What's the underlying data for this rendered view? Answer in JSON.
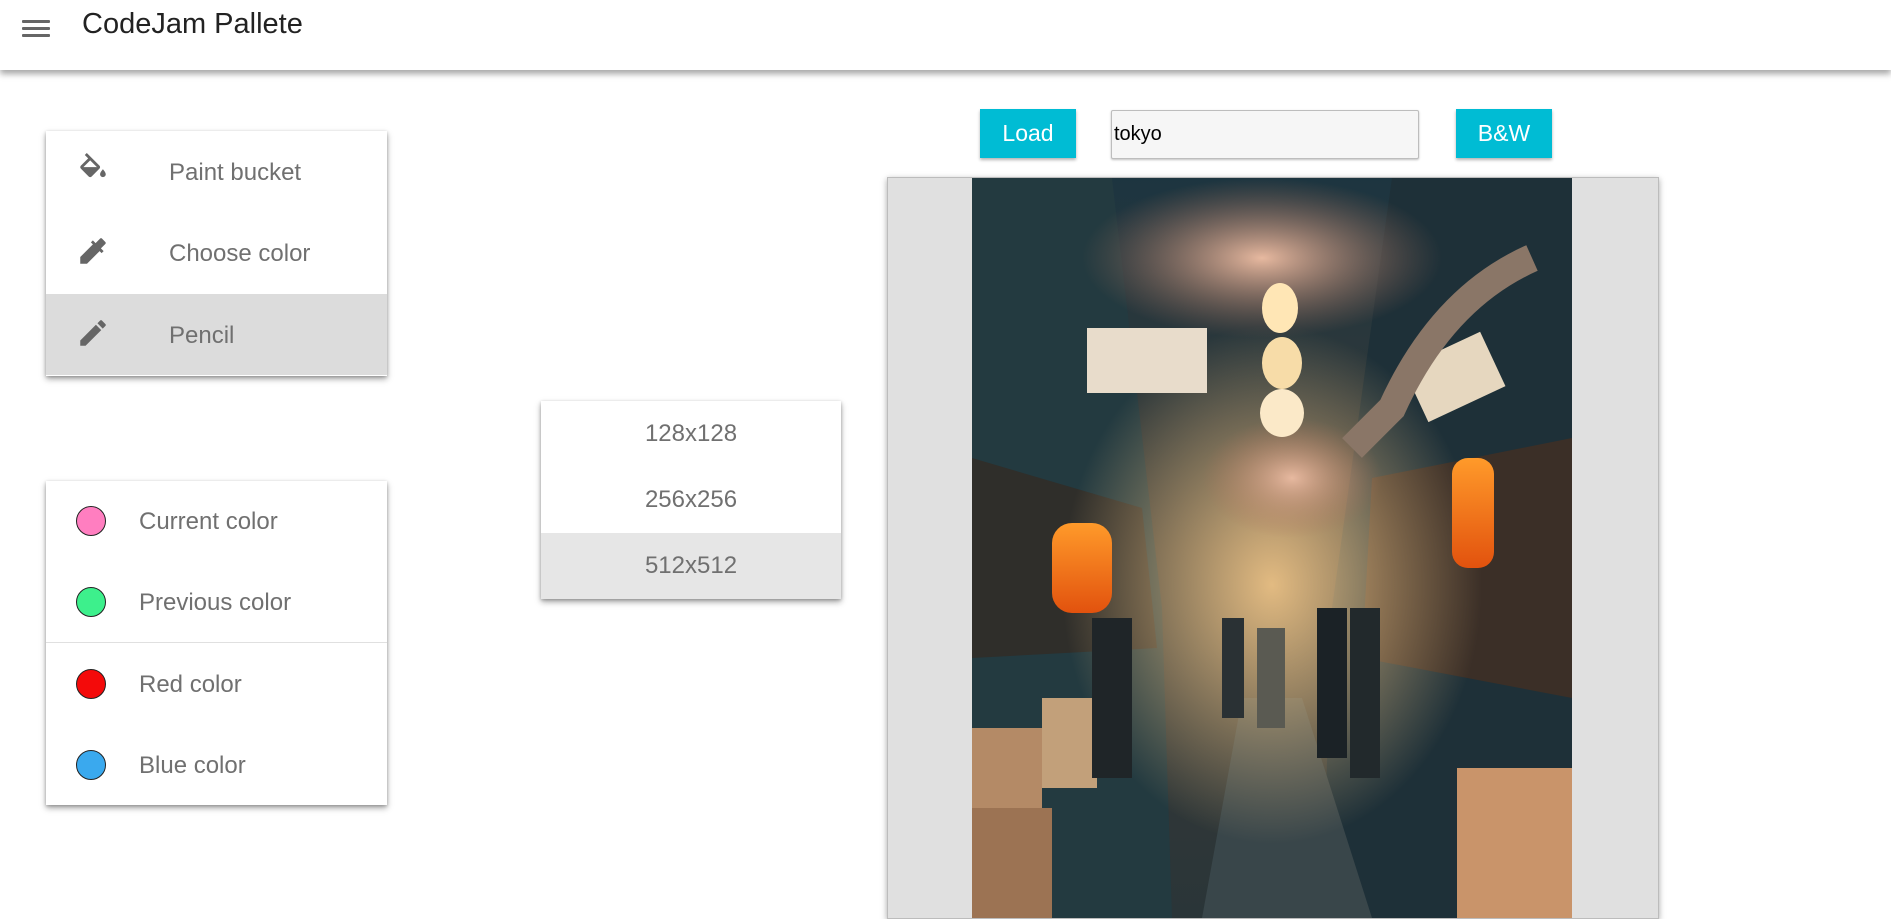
{
  "app": {
    "title": "CodeJam Pallete"
  },
  "tools": {
    "items": [
      {
        "id": "paint-bucket",
        "label": "Paint bucket",
        "icon": "paint-bucket-icon",
        "active": false
      },
      {
        "id": "choose-color",
        "label": "Choose color",
        "icon": "eyedropper-icon",
        "active": false
      },
      {
        "id": "pencil",
        "label": "Pencil",
        "icon": "pencil-icon",
        "active": true
      }
    ]
  },
  "colors": {
    "items": [
      {
        "id": "current",
        "label": "Current color",
        "color": "#ff7ec0"
      },
      {
        "id": "previous",
        "label": "Previous color",
        "color": "#3df08c"
      },
      {
        "id": "red",
        "label": "Red color",
        "color": "#f40a0a"
      },
      {
        "id": "blue",
        "label": "Blue color",
        "color": "#3aa9ee"
      }
    ]
  },
  "sizes": {
    "items": [
      {
        "label": "128x128",
        "active": false
      },
      {
        "label": "256x256",
        "active": false
      },
      {
        "label": "512x512",
        "active": true
      }
    ]
  },
  "toolbar": {
    "load_label": "Load",
    "search_value": "tokyo",
    "bw_label": "B&W",
    "accent": "#00bcd4"
  }
}
